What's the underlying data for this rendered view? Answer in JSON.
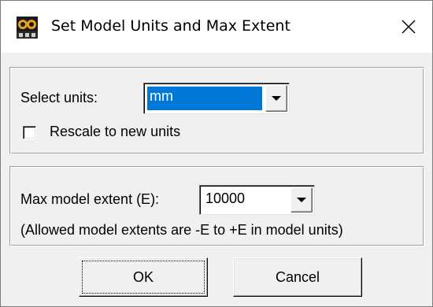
{
  "window": {
    "title": "Set Model Units and Max Extent",
    "app_icon": "edt-logo-icon",
    "close_icon": "close-icon"
  },
  "units_group": {
    "select_label": "Select units:",
    "select_value": "mm",
    "rescale_label": "Rescale to new units",
    "rescale_checked": false
  },
  "extent_group": {
    "extent_label": "Max model extent (E):",
    "extent_value": "10000",
    "note": "(Allowed model extents are -E to +E in model units)"
  },
  "buttons": {
    "ok_label": "OK",
    "cancel_label": "Cancel"
  },
  "colors": {
    "selection": "#0078d7",
    "dialog_bg": "#f0f0f0",
    "titlebar_bg": "#ffffff"
  }
}
